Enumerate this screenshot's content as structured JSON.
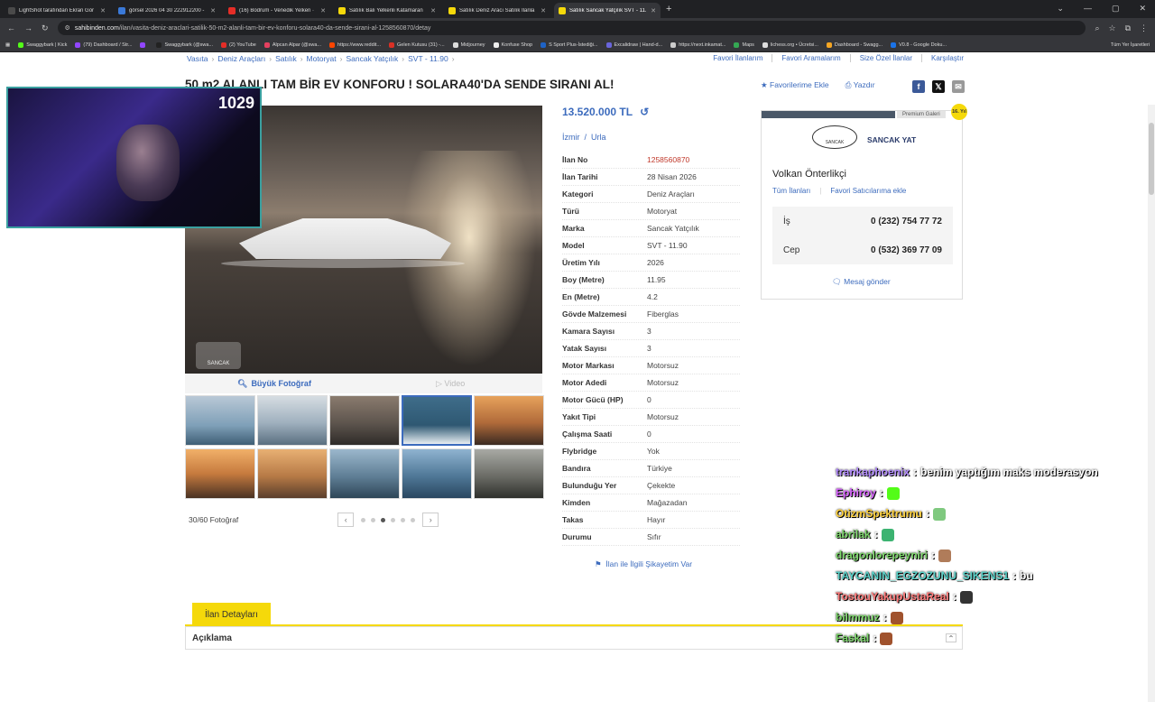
{
  "browser": {
    "tabs": [
      {
        "title": "LightShot tarafından Ekran Gör",
        "color": "#4a4a4a",
        "active": false
      },
      {
        "title": "görsel 2026 04 30 222912200 -",
        "color": "#3a79d8",
        "active": false
      },
      {
        "title": "(16) Bodrum - Venedik Yelken ·",
        "color": "#e52d27",
        "active": false
      },
      {
        "title": "Satılık Balı Yelkenli Katamaran",
        "color": "#f5d90a",
        "active": false
      },
      {
        "title": "Satılık Deniz Aracı Satılık İlanla",
        "color": "#f5d90a",
        "active": false
      },
      {
        "title": "Satılık Sancak Yatçılık SVT - 11.",
        "color": "#f5d90a",
        "active": true
      }
    ],
    "url_domain": "sahibinden.com",
    "url_path": "/ilan/vasita-deniz-araclari-satilik-50-m2-alanli-tam-bir-ev-konforu-solara40-da-sende-sirani-al-1258560870/detay",
    "bookmarks": [
      {
        "label": "Swaggybark | Kick",
        "color": "#53fc18"
      },
      {
        "label": "(79) Dashboard / Str...",
        "color": "#9146ff"
      },
      {
        "label": "",
        "color": "#9146ff"
      },
      {
        "label": "Swaggybark (@swa...",
        "color": "#222"
      },
      {
        "label": "(2) YouTube",
        "color": "#e52d27"
      },
      {
        "label": "Alpcan Alpar (@swa...",
        "color": "#e4405f"
      },
      {
        "label": "https://www.reddit...",
        "color": "#ff4500"
      },
      {
        "label": "Gelen Kutusu (31) -...",
        "color": "#d93025"
      },
      {
        "label": "Midjourney",
        "color": "#ddd"
      },
      {
        "label": "Konfuse Shop",
        "color": "#eee"
      },
      {
        "label": "S Sport Plus-İstediği...",
        "color": "#1e63c6"
      },
      {
        "label": "Excalidraw | Hand-d...",
        "color": "#6965db"
      },
      {
        "label": "https://next.inkamat...",
        "color": "#ccc"
      },
      {
        "label": "Maps",
        "color": "#34a853"
      },
      {
        "label": "lichess.org • Ücretsi...",
        "color": "#ddd"
      },
      {
        "label": "Dashboard - Swagg...",
        "color": "#f5a623"
      },
      {
        "label": "V0.8 - Google Doku...",
        "color": "#1a73e8"
      }
    ],
    "all_bookmarks": "Tüm Yer İşaretleri"
  },
  "breadcrumb": [
    "Vasıta",
    "Deniz Araçları",
    "Satılık",
    "Motoryat",
    "Sancak Yatçılık",
    "SVT - 11.90"
  ],
  "top_links": [
    "Favori İlanlarım",
    "Favori Aramalarım",
    "Size Özel İlanlar",
    "Karşılaştır"
  ],
  "listing": {
    "title": "50 m2 ALANLI TAM BİR EV KONFORU ! SOLARA40'DA SENDE SIRANI AL!",
    "fav_label": "Favorilerime Ekle",
    "print_label": "Yazdır",
    "price": "13.520.000 TL",
    "city": "İzmir",
    "district": "Urla",
    "photo_watermark": "SANCAK",
    "big_photo_label": "Büyük Fotoğraf",
    "video_label": "Video",
    "photo_count": "30/60 Fotoğraf",
    "complain_label": "İlan ile İlgili Şikayetim Var"
  },
  "thumbnails": [
    {
      "bg": "linear-gradient(180deg,#b9c8d6,#7fa0b8 60%,#3e5e75)"
    },
    {
      "bg": "linear-gradient(180deg,#d6dde2,#9fb0be 55%,#5a6f80)"
    },
    {
      "bg": "linear-gradient(180deg,#8a7b6e,#5e554e 55%,#2e2b28)"
    },
    {
      "bg": "linear-gradient(180deg,#3f6d8a,#2e5872 60%,#e8eef2)"
    },
    {
      "bg": "linear-gradient(180deg,#e7a25b,#b06a3a 55%,#3b2a22)"
    },
    {
      "bg": "linear-gradient(180deg,#f1b069,#c67a3e 50%,#4a3224)"
    },
    {
      "bg": "linear-gradient(180deg,#e8b073,#b77a46 55%,#5a3e2c)"
    },
    {
      "bg": "linear-gradient(180deg,#9bb7cc,#607f96 55%,#2e4658)"
    },
    {
      "bg": "linear-gradient(180deg,#8fb3d0,#4f7897 55%,#2a4760)"
    },
    {
      "bg": "linear-gradient(180deg,#a8a9a4,#6b6c66 55%,#2f302c)"
    }
  ],
  "details": [
    {
      "key": "İlan No",
      "value": "1258560870",
      "highlight": true
    },
    {
      "key": "İlan Tarihi",
      "value": "28 Nisan 2026"
    },
    {
      "key": "Kategori",
      "value": "Deniz Araçları"
    },
    {
      "key": "Türü",
      "value": "Motoryat"
    },
    {
      "key": "Marka",
      "value": "Sancak Yatçılık"
    },
    {
      "key": "Model",
      "value": "SVT - 11.90"
    },
    {
      "key": "Üretim Yılı",
      "value": "2026"
    },
    {
      "key": "Boy (Metre)",
      "value": "11.95"
    },
    {
      "key": "En (Metre)",
      "value": "4.2"
    },
    {
      "key": "Gövde Malzemesi",
      "value": "Fiberglas"
    },
    {
      "key": "Kamara Sayısı",
      "value": "3"
    },
    {
      "key": "Yatak Sayısı",
      "value": "3"
    },
    {
      "key": "Motor Markası",
      "value": "Motorsuz"
    },
    {
      "key": "Motor Adedi",
      "value": "Motorsuz"
    },
    {
      "key": "Motor Gücü (HP)",
      "value": "0"
    },
    {
      "key": "Yakıt Tipi",
      "value": "Motorsuz"
    },
    {
      "key": "Çalışma Saati",
      "value": "0"
    },
    {
      "key": "Flybridge",
      "value": "Yok"
    },
    {
      "key": "Bandıra",
      "value": "Türkiye"
    },
    {
      "key": "Bulunduğu Yer",
      "value": "Çekekte"
    },
    {
      "key": "Kimden",
      "value": "Mağazadan"
    },
    {
      "key": "Takas",
      "value": "Hayır"
    },
    {
      "key": "Durumu",
      "value": "Sıfır"
    }
  ],
  "seller": {
    "premium_label": "Premium Galeri",
    "years_badge": "16. Yıl",
    "logo_text": "SANCAK",
    "store_name": "SANCAK YAT",
    "person": "Volkan Önterlikçi",
    "all_listings": "Tüm İlanları",
    "fav_seller": "Favori Satıcılarıma ekle",
    "phones": [
      {
        "label": "İş",
        "number": "0 (232) 754 77 72"
      },
      {
        "label": "Cep",
        "number": "0 (532) 369 77 09"
      }
    ],
    "message": "Mesaj gönder"
  },
  "section": {
    "tab_label": "İlan Detayları",
    "desc_label": "Açıklama"
  },
  "overlay": {
    "viewer_count": "1029",
    "chat": [
      {
        "user": "trankaphoenix",
        "color": "#b48cff",
        "msg": "benim yaptığım maks moderasyon"
      },
      {
        "user": "Ephiroy",
        "color": "#d966ff",
        "msg": ""
      },
      {
        "user": "OtizmSpektrumu",
        "color": "#ffd23c",
        "msg": ""
      },
      {
        "user": "abrilak",
        "color": "#7cd66a",
        "msg": ""
      },
      {
        "user": "dragonlorepeyniri",
        "color": "#7cd66a",
        "msg": ""
      },
      {
        "user": "TAYCANIN_EGZOZUNU_SIKENS1",
        "color": "#5ad1c8",
        "msg": "bu"
      },
      {
        "user": "TostouYakupUstaReal",
        "color": "#ff7a7a",
        "msg": ""
      },
      {
        "user": "bilmmuz",
        "color": "#7cd66a",
        "msg": ""
      },
      {
        "user": "Faskal",
        "color": "#7cd66a",
        "msg": ""
      }
    ]
  }
}
